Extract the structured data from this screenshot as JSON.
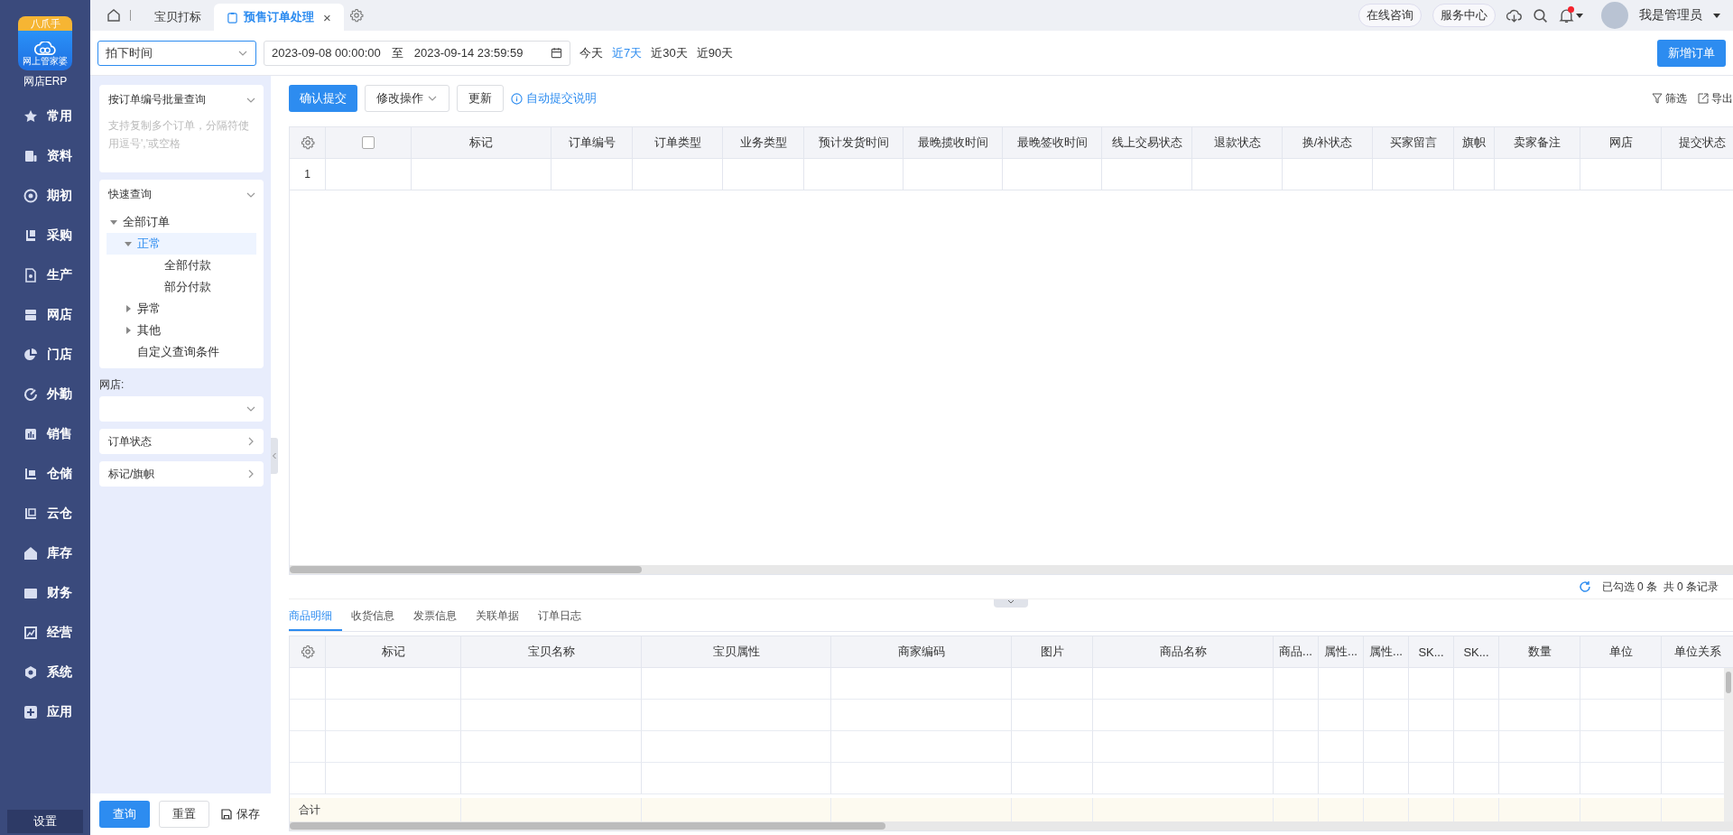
{
  "app": {
    "logo_badge": "八爪手",
    "logo_caption": "网上管家婆",
    "name": "网店ERP"
  },
  "nav": {
    "items": [
      {
        "label": "常用"
      },
      {
        "label": "资料"
      },
      {
        "label": "期初"
      },
      {
        "label": "采购"
      },
      {
        "label": "生产"
      },
      {
        "label": "网店"
      },
      {
        "label": "门店"
      },
      {
        "label": "外勤"
      },
      {
        "label": "销售"
      },
      {
        "label": "仓储"
      },
      {
        "label": "云仓"
      },
      {
        "label": "库存"
      },
      {
        "label": "财务"
      },
      {
        "label": "经营"
      },
      {
        "label": "系统"
      },
      {
        "label": "应用"
      }
    ],
    "footer": "设置"
  },
  "tabs": [
    {
      "label": "宝贝打标",
      "selected": false
    },
    {
      "label": "预售订单处理",
      "selected": true,
      "close_label": "×"
    }
  ],
  "header_right": {
    "buttons": [
      "在线咨询",
      "服务中心"
    ],
    "notifications_unread": true,
    "user": "我是管理员"
  },
  "filter": {
    "date_type": "拍下时间",
    "date_from": "2023-09-08 00:00:00",
    "separator": "至",
    "date_to": "2023-09-14 23:59:59",
    "shortcuts": [
      {
        "label": "今天",
        "selected": false
      },
      {
        "label": "近7天",
        "selected": true
      },
      {
        "label": "近30天",
        "selected": false
      },
      {
        "label": "近90天",
        "selected": false
      }
    ],
    "new_button": "新增订单"
  },
  "left_panel": {
    "batch_query": {
      "title": "按订单编号批量查询",
      "expanded": true,
      "placeholder": "支持复制多个订单，分隔符使用逗号','或空格"
    },
    "quick_query": {
      "title": "快速查询",
      "expanded": true,
      "tree": [
        {
          "label": "全部订单",
          "expanded": true,
          "selected": false,
          "children": [
            {
              "label": "正常",
              "expanded": true,
              "selected": true,
              "children": [
                {
                  "label": "全部付款",
                  "selected": false
                },
                {
                  "label": "部分付款",
                  "selected": false
                }
              ]
            },
            {
              "label": "异常",
              "expanded": false,
              "selected": false
            },
            {
              "label": "其他",
              "expanded": false,
              "selected": false
            },
            {
              "label": "自定义查询条件",
              "selected": false
            }
          ]
        }
      ]
    },
    "shop_label": "网店:",
    "collapsed_sections": [
      {
        "title": "订单状态",
        "expanded": false
      },
      {
        "title": "标记/旗帜",
        "expanded": false
      }
    ],
    "buttons": {
      "query": "查询",
      "reset": "重置",
      "save": "保存"
    }
  },
  "toolbar": {
    "confirm": "确认提交",
    "modify": "修改操作",
    "refresh": "更新",
    "help_link": "自动提交说明",
    "filter": "筛选",
    "export": "导出"
  },
  "orders_table": {
    "header_checked": false,
    "columns": [
      "标记",
      "订单编号",
      "订单类型",
      "业务类型",
      "预计发货时间",
      "最晚揽收时间",
      "最晚签收时间",
      "线上交易状态",
      "退款状态",
      "换/补状态",
      "买家留言",
      "旗帜",
      "卖家备注",
      "网店",
      "提交状态"
    ],
    "rows": [
      {
        "index": "1"
      }
    ]
  },
  "status": "已勾选 0 条  共 0 条记录",
  "detail_tabs": [
    {
      "label": "商品明细",
      "selected": true
    },
    {
      "label": "收货信息",
      "selected": false
    },
    {
      "label": "发票信息",
      "selected": false
    },
    {
      "label": "关联单据",
      "selected": false
    },
    {
      "label": "订单日志",
      "selected": false
    }
  ],
  "detail_table": {
    "columns": [
      "标记",
      "宝贝名称",
      "宝贝属性",
      "商家编码",
      "图片",
      "商品名称",
      "商品...",
      "属性...",
      "属性...",
      "SK...",
      "SK...",
      "数量",
      "单位",
      "单位关系"
    ],
    "total_label": "合计"
  }
}
